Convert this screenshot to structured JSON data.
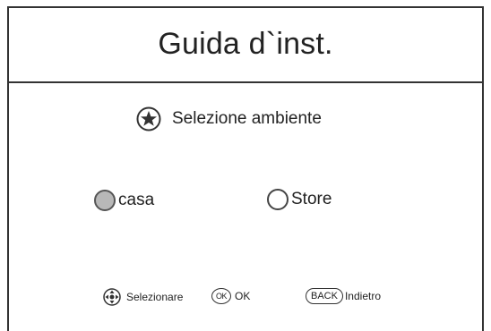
{
  "header": {
    "title": "Guida d`inst."
  },
  "section": {
    "heading": "Selezione ambiente",
    "icon": "star-circle-icon"
  },
  "options": [
    {
      "label": "casa",
      "selected": true
    },
    {
      "label": "Store",
      "selected": false
    }
  ],
  "footer": {
    "select_icon": "dpad-icon",
    "select_label": "Selezionare",
    "ok_key": "OK",
    "ok_label": "OK",
    "back_key": "BACK",
    "back_label": "Indietro"
  },
  "colors": {
    "border": "#333333",
    "selected_fill": "#b8b8b8",
    "background": "#ffffff"
  }
}
